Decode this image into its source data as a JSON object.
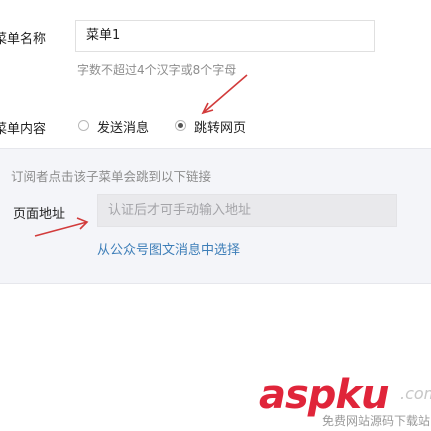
{
  "menu_name": {
    "label": "菜单名称",
    "value": "菜单1",
    "hint": "字数不超过4个汉字或8个字母"
  },
  "menu_content": {
    "label": "菜单内容",
    "options": [
      {
        "label": "发送消息",
        "checked": false
      },
      {
        "label": "跳转网页",
        "checked": true
      }
    ]
  },
  "jump_panel": {
    "description": "订阅者点击该子菜单会跳到以下链接",
    "page_url_label": "页面地址",
    "page_url_placeholder": "认证后才可手动输入地址",
    "choose_link": "从公众号图文消息中选择"
  },
  "watermark": {
    "main": "aspku",
    "suffix": ".com",
    "subtitle": "免费网站源码下载站!"
  },
  "colors": {
    "arrow": "#d23b3b",
    "link": "#3d7eb8",
    "panel_bg": "#f4f5f9",
    "watermark_red": "#e0253a"
  }
}
